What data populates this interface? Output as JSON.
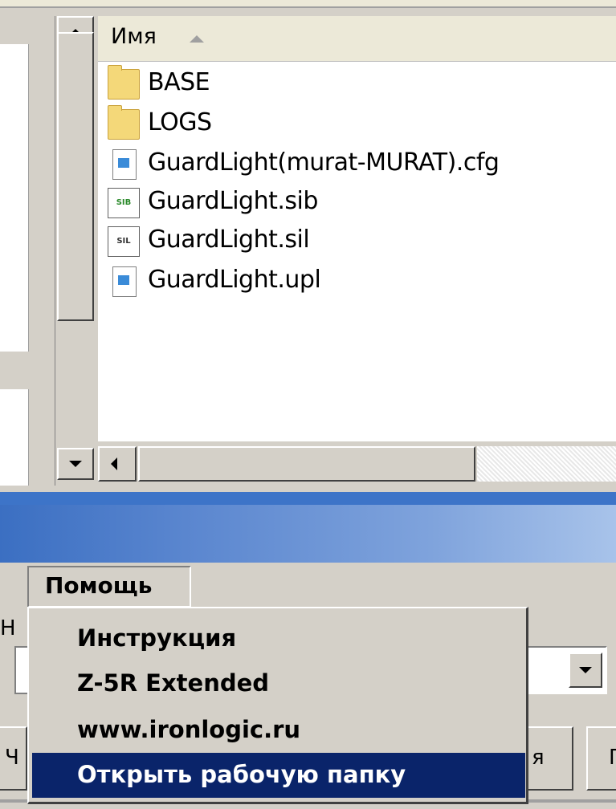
{
  "file_pane": {
    "column_name": "Имя",
    "files": [
      {
        "name": "BASE",
        "icon": "folder-icon"
      },
      {
        "name": "LOGS",
        "icon": "folder-icon"
      },
      {
        "name": "GuardLight(murat-MURAT).cfg",
        "icon": "config-file-icon"
      },
      {
        "name": "GuardLight.sib",
        "icon": "sib-file-icon",
        "badge": "SIB"
      },
      {
        "name": "GuardLight.sil",
        "icon": "sil-file-icon",
        "badge": "SIL"
      },
      {
        "name": "GuardLight.upl",
        "icon": "upl-file-icon"
      }
    ]
  },
  "menubar": {
    "help": "Помощь"
  },
  "help_menu": {
    "items": [
      {
        "label": "Инструкция"
      },
      {
        "label": "Z-5R Extended"
      },
      {
        "label": "www.ironlogic.ru"
      },
      {
        "label": "Открыть рабочую папку",
        "selected": true
      }
    ]
  },
  "background_dialog": {
    "label_fragment": "Н",
    "button_left_fragment": "Ч",
    "button_mid_fragment": "я",
    "button_right_fragment": "Г"
  },
  "colors": {
    "selection": "#0a246a",
    "titlebar_start": "#3b6fc2",
    "titlebar_end": "#a8c3ea",
    "face": "#d4d0c8"
  }
}
